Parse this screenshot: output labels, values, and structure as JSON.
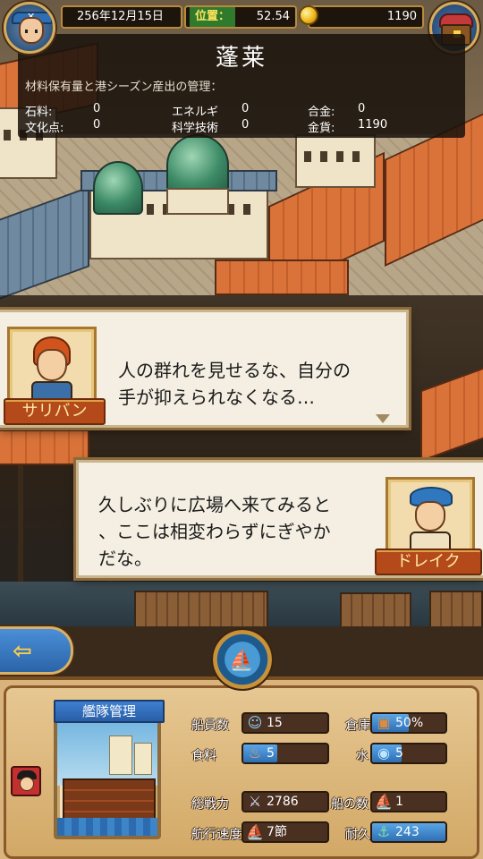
{
  "top_bar": {
    "date": "256年12月15日",
    "position_label": "位置：",
    "position_value": "52.54",
    "gold": "1190"
  },
  "info_panel": {
    "port_name": "蓬莱",
    "header": "材料保有量と港シーズン産出の管理：",
    "rows": [
      [
        {
          "label": "石料:",
          "value": "0"
        },
        {
          "label": "エネルギ",
          "value": "0"
        },
        {
          "label": "合金:",
          "value": "0"
        }
      ],
      [
        {
          "label": "文化点:",
          "value": "0"
        },
        {
          "label": "科学技術",
          "value": "0"
        },
        {
          "label": "金貨:",
          "value": "1190"
        }
      ]
    ]
  },
  "dialogue": [
    {
      "speaker": "サリバン",
      "line1": "人の群れを見せるな、自分の",
      "line2": "手が抑えられなくなる…"
    },
    {
      "speaker": "ドレイク",
      "line1": "久しぶりに広場へ来てみると",
      "line2": "、ここは相変わらずにぎやか",
      "line3": "だな。"
    }
  ],
  "fleet": {
    "title": "艦隊管理",
    "stats": {
      "crew": {
        "label": "船員数",
        "value": "15",
        "icon": "sailor-icon"
      },
      "warehouse": {
        "label": "倉庫",
        "value": "50%",
        "fill": 0.5,
        "icon": "crate-icon"
      },
      "food": {
        "label": "食料",
        "value": "5",
        "icon": "meat-icon"
      },
      "water": {
        "label": "水",
        "value": "5",
        "icon": "water-icon"
      },
      "power": {
        "label": "総戦力",
        "value": "2786",
        "icon": "swords-icon"
      },
      "ships": {
        "label": "船の数",
        "value": "1",
        "icon": "ship-icon"
      },
      "speed": {
        "label": "航行速度",
        "value": "7節",
        "icon": "sail-icon"
      },
      "durability": {
        "label": "耐久",
        "value": "243",
        "fill": 1.0,
        "icon": "hull-icon"
      }
    }
  }
}
